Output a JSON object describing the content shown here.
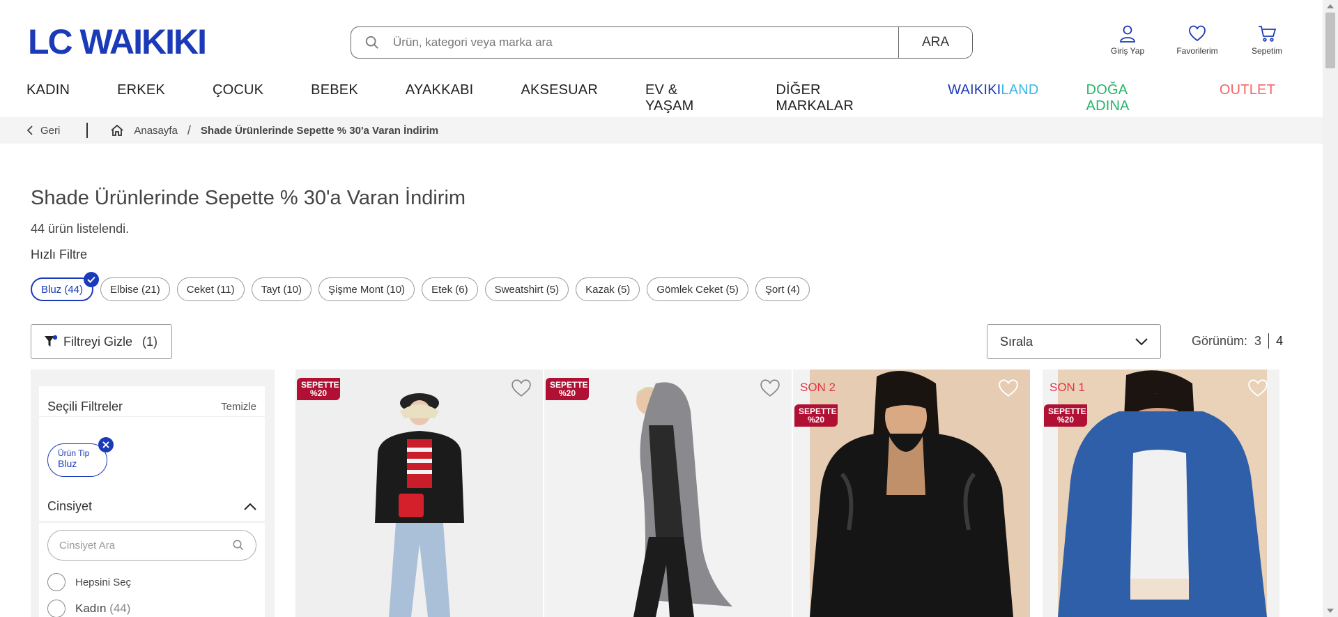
{
  "brand": {
    "logo_text": "LC WAIKIKI",
    "color": "#1a3ab8"
  },
  "search": {
    "placeholder": "Ürün, kategori veya marka ara",
    "button_label": "ARA"
  },
  "header_actions": [
    {
      "label": "Giriş Yap",
      "icon": "user-icon"
    },
    {
      "label": "Favorilerim",
      "icon": "heart-icon"
    },
    {
      "label": "Sepetim",
      "icon": "cart-icon"
    }
  ],
  "nav": {
    "items": [
      "KADIN",
      "ERKEK",
      "ÇOCUK",
      "BEBEK",
      "AYAKKABI",
      "AKSESUAR",
      "EV & YAŞAM",
      "DİĞER MARKALAR"
    ],
    "waikikiland_part1": "WAIKIKI",
    "waikikiland_part2": "LAND",
    "doga": "DOĞA ADINA",
    "outlet": "OUTLET"
  },
  "breadcrumb": {
    "back": "Geri",
    "home": "Anasayfa",
    "current": "Shade Ürünlerinde Sepette % 30'a Varan İndirim"
  },
  "page": {
    "title": "Shade Ürünlerinde Sepette % 30'a Varan İndirim",
    "count_text": "44 ürün listelendi.",
    "quick_filter_label": "Hızlı Filtre"
  },
  "quick_filters": [
    {
      "label": "Bluz (44)",
      "active": true
    },
    {
      "label": "Elbise (21)"
    },
    {
      "label": "Ceket (11)"
    },
    {
      "label": "Tayt (10)"
    },
    {
      "label": "Şişme Mont (10)"
    },
    {
      "label": "Etek (6)"
    },
    {
      "label": "Sweatshirt (5)"
    },
    {
      "label": "Kazak (5)"
    },
    {
      "label": "Gömlek Ceket (5)"
    },
    {
      "label": "Şort (4)"
    }
  ],
  "toolbar": {
    "filter_label": "Filtreyi Gizle",
    "filter_count": "(1)",
    "sort_label": "Sırala",
    "view_label": "Görünüm:",
    "view_3": "3",
    "view_4": "4"
  },
  "sidebar": {
    "selected_title": "Seçili Filtreler",
    "clear_label": "Temizle",
    "selected_tag_key": "Ürün Tip",
    "selected_tag_value": "Bluz",
    "gender_title": "Cinsiyet",
    "gender_search_placeholder": "Cinsiyet Ara",
    "select_all": "Hepsini Seç",
    "option_kadin": "Kadın",
    "option_kadin_count": "(44)"
  },
  "products": [
    {
      "badge": "SEPETTE %20",
      "son": ""
    },
    {
      "badge": "SEPETTE %20",
      "son": ""
    },
    {
      "badge": "SEPETTE %20",
      "son": "SON 2"
    },
    {
      "badge": "SEPETTE %20",
      "son": "SON 1"
    }
  ],
  "colors": {
    "accent": "#1a3ab8",
    "doga": "#24b46a",
    "outlet": "#f26464",
    "badge": "#b01033",
    "son": "#e23446"
  }
}
